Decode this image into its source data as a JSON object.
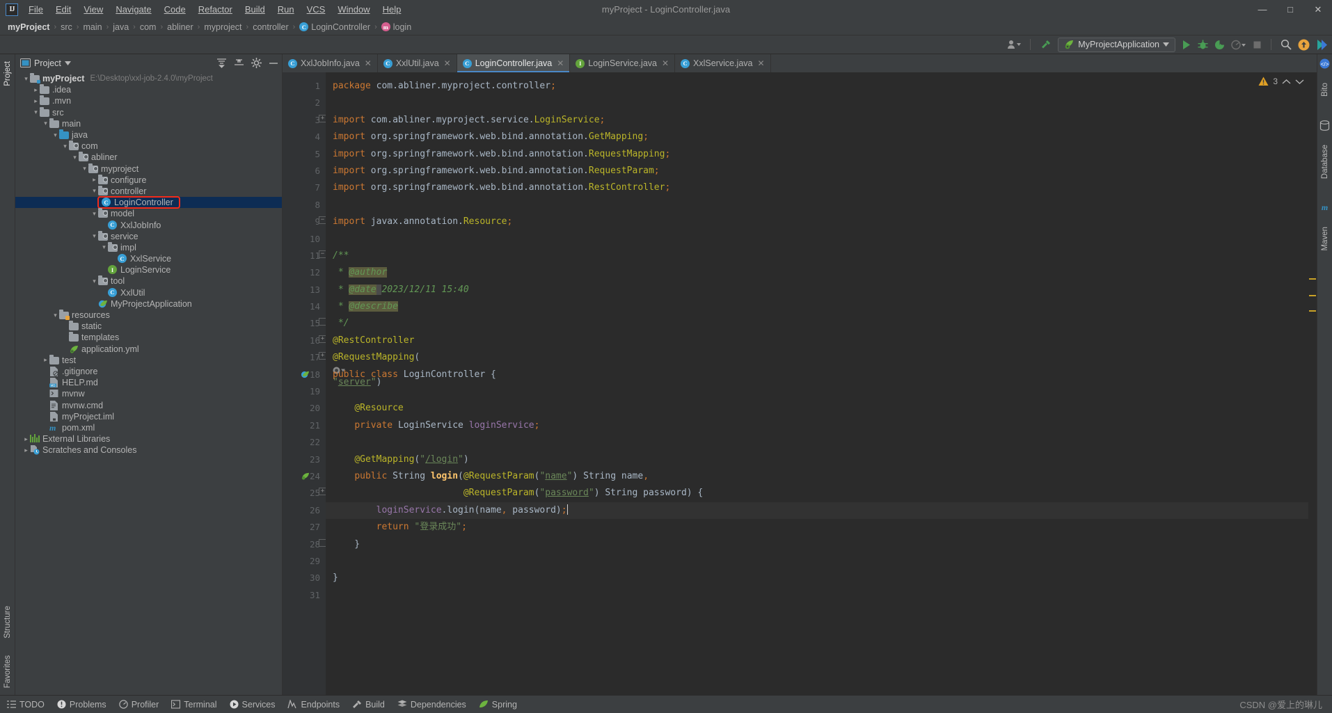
{
  "window": {
    "title": "myProject - LoginController.java",
    "buttons": [
      "minimize",
      "maximize",
      "close"
    ]
  },
  "menu": {
    "items": [
      {
        "label": "File"
      },
      {
        "label": "Edit"
      },
      {
        "label": "View"
      },
      {
        "label": "Navigate"
      },
      {
        "label": "Code"
      },
      {
        "label": "Refactor"
      },
      {
        "label": "Build"
      },
      {
        "label": "Run"
      },
      {
        "label": "VCS"
      },
      {
        "label": "Window"
      },
      {
        "label": "Help"
      }
    ]
  },
  "breadcrumb": {
    "items": [
      {
        "label": "myProject",
        "bold": true,
        "icon": ""
      },
      {
        "label": "src",
        "icon": ""
      },
      {
        "label": "main",
        "icon": ""
      },
      {
        "label": "java",
        "icon": ""
      },
      {
        "label": "com",
        "icon": ""
      },
      {
        "label": "abliner",
        "icon": ""
      },
      {
        "label": "myproject",
        "icon": ""
      },
      {
        "label": "controller",
        "icon": ""
      },
      {
        "label": "LoginController",
        "icon": "class-icon"
      },
      {
        "label": "login",
        "icon": "method-icon"
      }
    ],
    "separator": "›"
  },
  "toolbar": {
    "run_config": "MyProjectApplication",
    "icons": [
      {
        "name": "user-profile-icon"
      },
      {
        "name": "build-hammer-icon"
      },
      {
        "name": "run-icon"
      },
      {
        "name": "debug-icon"
      },
      {
        "name": "run-coverage-icon"
      },
      {
        "name": "profiler-dropdown-icon"
      },
      {
        "name": "stop-icon"
      },
      {
        "name": "search-everywhere-icon"
      },
      {
        "name": "update-icon"
      },
      {
        "name": "bito-icon"
      }
    ]
  },
  "project_panel": {
    "title": "Project",
    "actions": [
      "expand-all-icon",
      "collapse-all-icon",
      "settings-gear-icon",
      "hide-icon"
    ],
    "tree": [
      {
        "depth": 0,
        "arrow": "down",
        "icon": "module-folder",
        "label": "myProject",
        "bold": true,
        "sub": "E:\\Desktop\\xxl-job-2.4.0\\myProject"
      },
      {
        "depth": 1,
        "arrow": "right",
        "icon": "folder",
        "label": ".idea"
      },
      {
        "depth": 1,
        "arrow": "right",
        "icon": "folder",
        "label": ".mvn"
      },
      {
        "depth": 1,
        "arrow": "down",
        "icon": "folder",
        "label": "src"
      },
      {
        "depth": 2,
        "arrow": "down",
        "icon": "folder",
        "label": "main"
      },
      {
        "depth": 3,
        "arrow": "down",
        "icon": "source-folder",
        "label": "java"
      },
      {
        "depth": 4,
        "arrow": "down",
        "icon": "package-folder",
        "label": "com"
      },
      {
        "depth": 5,
        "arrow": "down",
        "icon": "package-folder",
        "label": "abliner"
      },
      {
        "depth": 6,
        "arrow": "down",
        "icon": "package-folder",
        "label": "myproject"
      },
      {
        "depth": 7,
        "arrow": "right",
        "icon": "package-folder",
        "label": "configure"
      },
      {
        "depth": 7,
        "arrow": "down",
        "icon": "package-folder",
        "label": "controller"
      },
      {
        "depth": 8,
        "arrow": "none",
        "icon": "class-icon",
        "label": "LoginController",
        "selected": true,
        "highlight_box": true
      },
      {
        "depth": 7,
        "arrow": "down",
        "icon": "package-folder",
        "label": "model"
      },
      {
        "depth": 8,
        "arrow": "none",
        "icon": "class-icon",
        "label": "XxlJobInfo"
      },
      {
        "depth": 7,
        "arrow": "down",
        "icon": "package-folder",
        "label": "service"
      },
      {
        "depth": 8,
        "arrow": "down",
        "icon": "package-folder",
        "label": "impl"
      },
      {
        "depth": 9,
        "arrow": "none",
        "icon": "class-icon",
        "label": "XxlService"
      },
      {
        "depth": 8,
        "arrow": "none",
        "icon": "interface-icon",
        "label": "LoginService"
      },
      {
        "depth": 7,
        "arrow": "down",
        "icon": "package-folder",
        "label": "tool"
      },
      {
        "depth": 8,
        "arrow": "none",
        "icon": "class-icon",
        "label": "XxlUtil"
      },
      {
        "depth": 7,
        "arrow": "none",
        "icon": "spring-boot-icon",
        "label": "MyProjectApplication"
      },
      {
        "depth": 3,
        "arrow": "down",
        "icon": "resource-folder",
        "label": "resources"
      },
      {
        "depth": 4,
        "arrow": "none",
        "icon": "folder",
        "label": "static"
      },
      {
        "depth": 4,
        "arrow": "none",
        "icon": "folder",
        "label": "templates"
      },
      {
        "depth": 4,
        "arrow": "none",
        "icon": "spring-yml-icon",
        "label": "application.yml"
      },
      {
        "depth": 2,
        "arrow": "right",
        "icon": "folder",
        "label": "test"
      },
      {
        "depth": 2,
        "arrow": "none",
        "icon": "gitignore-icon",
        "label": ".gitignore"
      },
      {
        "depth": 2,
        "arrow": "none",
        "icon": "markdown-icon",
        "label": "HELP.md"
      },
      {
        "depth": 2,
        "arrow": "none",
        "icon": "script-icon",
        "label": "mvnw"
      },
      {
        "depth": 2,
        "arrow": "none",
        "icon": "cmd-icon",
        "label": "mvnw.cmd"
      },
      {
        "depth": 2,
        "arrow": "none",
        "icon": "iml-icon",
        "label": "myProject.iml"
      },
      {
        "depth": 2,
        "arrow": "none",
        "icon": "maven-icon",
        "label": "pom.xml"
      },
      {
        "depth": 0,
        "arrow": "right",
        "icon": "libraries-icon",
        "label": "External Libraries"
      },
      {
        "depth": 0,
        "arrow": "right",
        "icon": "scratches-icon",
        "label": "Scratches and Consoles"
      }
    ]
  },
  "editor": {
    "tabs": [
      {
        "label": "XxlJobInfo.java",
        "icon": "class-icon",
        "active": false
      },
      {
        "label": "XxlUtil.java",
        "icon": "class-icon",
        "active": false
      },
      {
        "label": "LoginController.java",
        "icon": "class-icon",
        "active": true
      },
      {
        "label": "LoginService.java",
        "icon": "interface-icon",
        "active": false
      },
      {
        "label": "XxlService.java",
        "icon": "class-icon",
        "active": false
      }
    ],
    "warning_count": "3",
    "line_numbers": [
      "1",
      "2",
      "3",
      "4",
      "5",
      "6",
      "7",
      "8",
      "9",
      "10",
      "11",
      "12",
      "13",
      "14",
      "15",
      "16",
      "17",
      "18",
      "19",
      "20",
      "21",
      "22",
      "23",
      "24",
      "25",
      "26",
      "27",
      "28",
      "29",
      "30",
      "31"
    ],
    "lines": [
      {
        "n": 1,
        "text": "package com.abliner.myproject.controller;"
      },
      {
        "n": 2,
        "text": ""
      },
      {
        "n": 3,
        "text": "import com.abliner.myproject.service.LoginService;"
      },
      {
        "n": 4,
        "text": "import org.springframework.web.bind.annotation.GetMapping;"
      },
      {
        "n": 5,
        "text": "import org.springframework.web.bind.annotation.RequestMapping;"
      },
      {
        "n": 6,
        "text": "import org.springframework.web.bind.annotation.RequestParam;"
      },
      {
        "n": 7,
        "text": "import org.springframework.web.bind.annotation.RestController;"
      },
      {
        "n": 8,
        "text": ""
      },
      {
        "n": 9,
        "text": "import javax.annotation.Resource;"
      },
      {
        "n": 10,
        "text": ""
      },
      {
        "n": 11,
        "text": "/**"
      },
      {
        "n": 12,
        "text": " * @author"
      },
      {
        "n": 13,
        "text": " * @date 2023/12/11 15:40"
      },
      {
        "n": 14,
        "text": " * @describe"
      },
      {
        "n": 15,
        "text": " */"
      },
      {
        "n": 16,
        "text": "@RestController"
      },
      {
        "n": 17,
        "text": "@RequestMapping(\"server\")"
      },
      {
        "n": 18,
        "text": "public class LoginController {"
      },
      {
        "n": 19,
        "text": ""
      },
      {
        "n": 20,
        "text": "    @Resource"
      },
      {
        "n": 21,
        "text": "    private LoginService loginService;"
      },
      {
        "n": 22,
        "text": ""
      },
      {
        "n": 23,
        "text": "    @GetMapping(\"/login\")"
      },
      {
        "n": 24,
        "text": "    public String login(@RequestParam(\"name\") String name,"
      },
      {
        "n": 25,
        "text": "                        @RequestParam(\"password\") String password) {"
      },
      {
        "n": 26,
        "text": "        loginService.login(name, password);"
      },
      {
        "n": 27,
        "text": "        return \"登录成功\";"
      },
      {
        "n": 28,
        "text": "    }"
      },
      {
        "n": 29,
        "text": ""
      },
      {
        "n": 30,
        "text": "}"
      },
      {
        "n": 31,
        "text": ""
      }
    ]
  },
  "tool_windows": {
    "left": [
      {
        "label": "Project",
        "active": true
      },
      {
        "label": "Structure"
      },
      {
        "label": "Favorites"
      }
    ],
    "right": [
      {
        "label": "Bito",
        "icon": "bito-icon"
      },
      {
        "label": "Database",
        "icon": "database-icon"
      },
      {
        "label": "Maven",
        "icon": "maven-icon"
      }
    ]
  },
  "statusbar": {
    "items": [
      {
        "label": "TODO",
        "icon": "todo-icon"
      },
      {
        "label": "Problems",
        "icon": "problems-icon"
      },
      {
        "label": "Profiler",
        "icon": "profiler-icon"
      },
      {
        "label": "Terminal",
        "icon": "terminal-icon"
      },
      {
        "label": "Services",
        "icon": "services-icon"
      },
      {
        "label": "Endpoints",
        "icon": "endpoints-icon"
      },
      {
        "label": "Build",
        "icon": "build-icon"
      },
      {
        "label": "Dependencies",
        "icon": "dependencies-icon"
      },
      {
        "label": "Spring",
        "icon": "spring-icon"
      }
    ],
    "watermark": "CSDN @爱上的琳儿"
  },
  "colors": {
    "accent": "#4a88c7",
    "selection": "#0d2c54",
    "highlight_box": "#f22b1a",
    "warning": "#e0a024",
    "panel_bg": "#3c3f41",
    "editor_bg": "#2b2b2b"
  }
}
